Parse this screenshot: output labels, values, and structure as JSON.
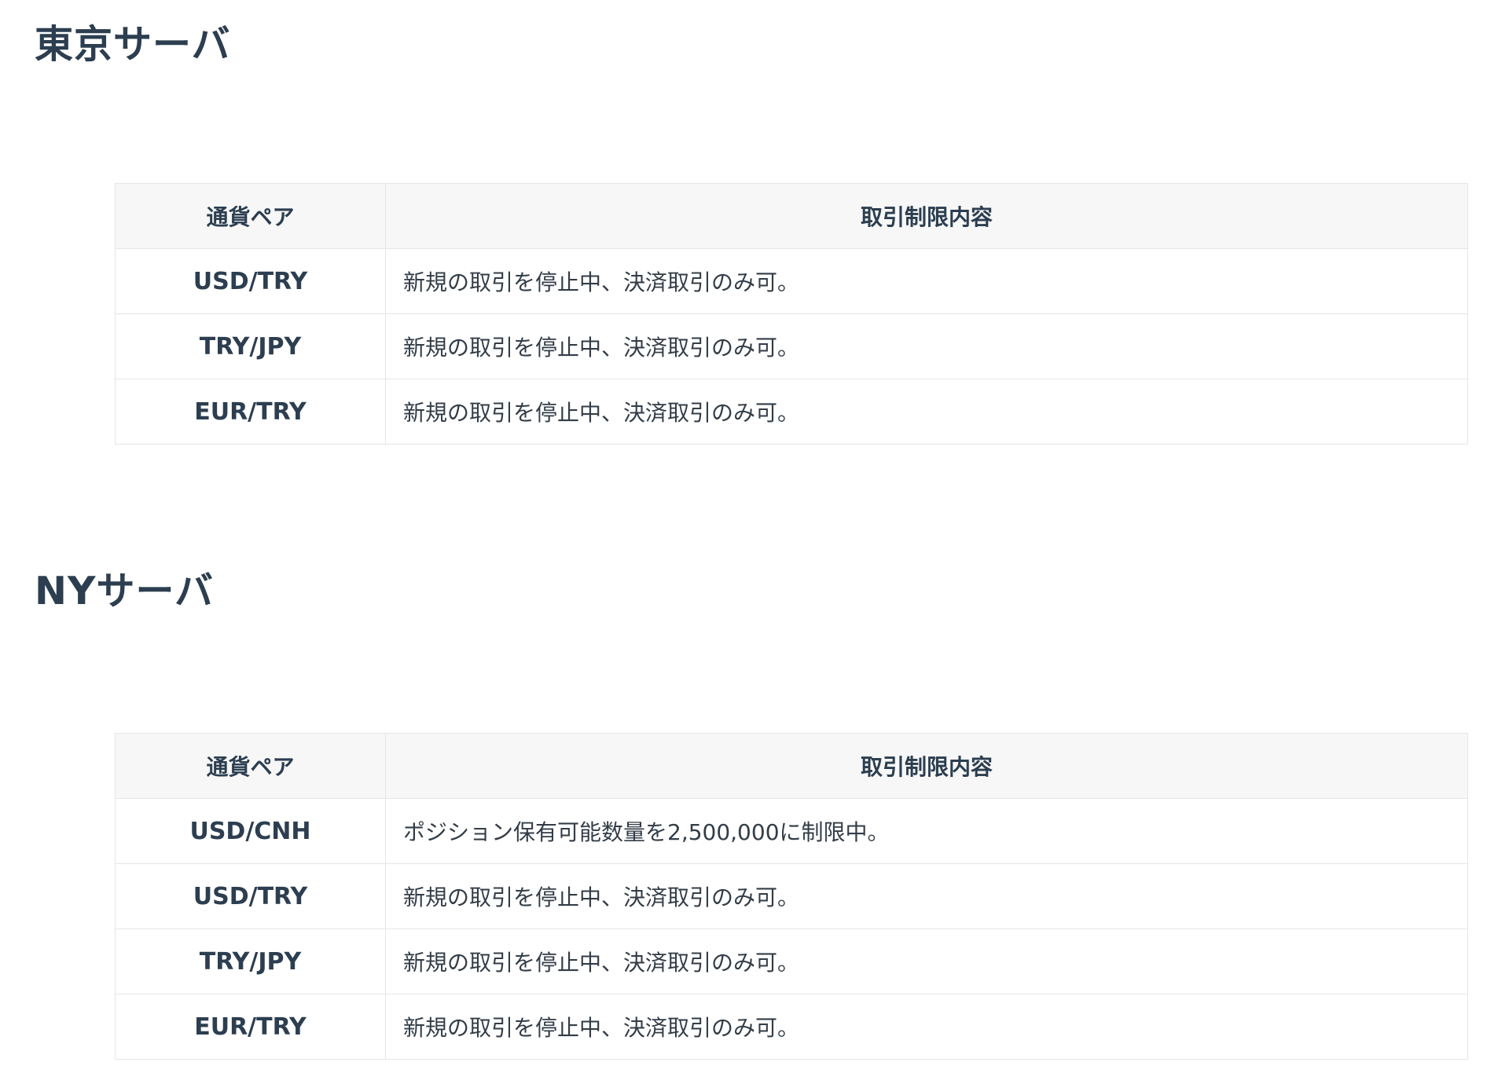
{
  "sections": [
    {
      "title": "東京サーバ",
      "headers": {
        "pair": "通貨ペア",
        "restriction": "取引制限内容"
      },
      "rows": [
        {
          "pair": "USD/TRY",
          "restriction": "新規の取引を停止中、決済取引のみ可。"
        },
        {
          "pair": "TRY/JPY",
          "restriction": "新規の取引を停止中、決済取引のみ可。"
        },
        {
          "pair": "EUR/TRY",
          "restriction": "新規の取引を停止中、決済取引のみ可。"
        }
      ]
    },
    {
      "title": "NYサーバ",
      "headers": {
        "pair": "通貨ペア",
        "restriction": "取引制限内容"
      },
      "rows": [
        {
          "pair": "USD/CNH",
          "restriction": "ポジション保有可能数量を2,500,000に制限中。"
        },
        {
          "pair": "USD/TRY",
          "restriction": "新規の取引を停止中、決済取引のみ可。"
        },
        {
          "pair": "TRY/JPY",
          "restriction": "新規の取引を停止中、決済取引のみ可。"
        },
        {
          "pair": "EUR/TRY",
          "restriction": "新規の取引を停止中、決済取引のみ可。"
        }
      ]
    }
  ]
}
